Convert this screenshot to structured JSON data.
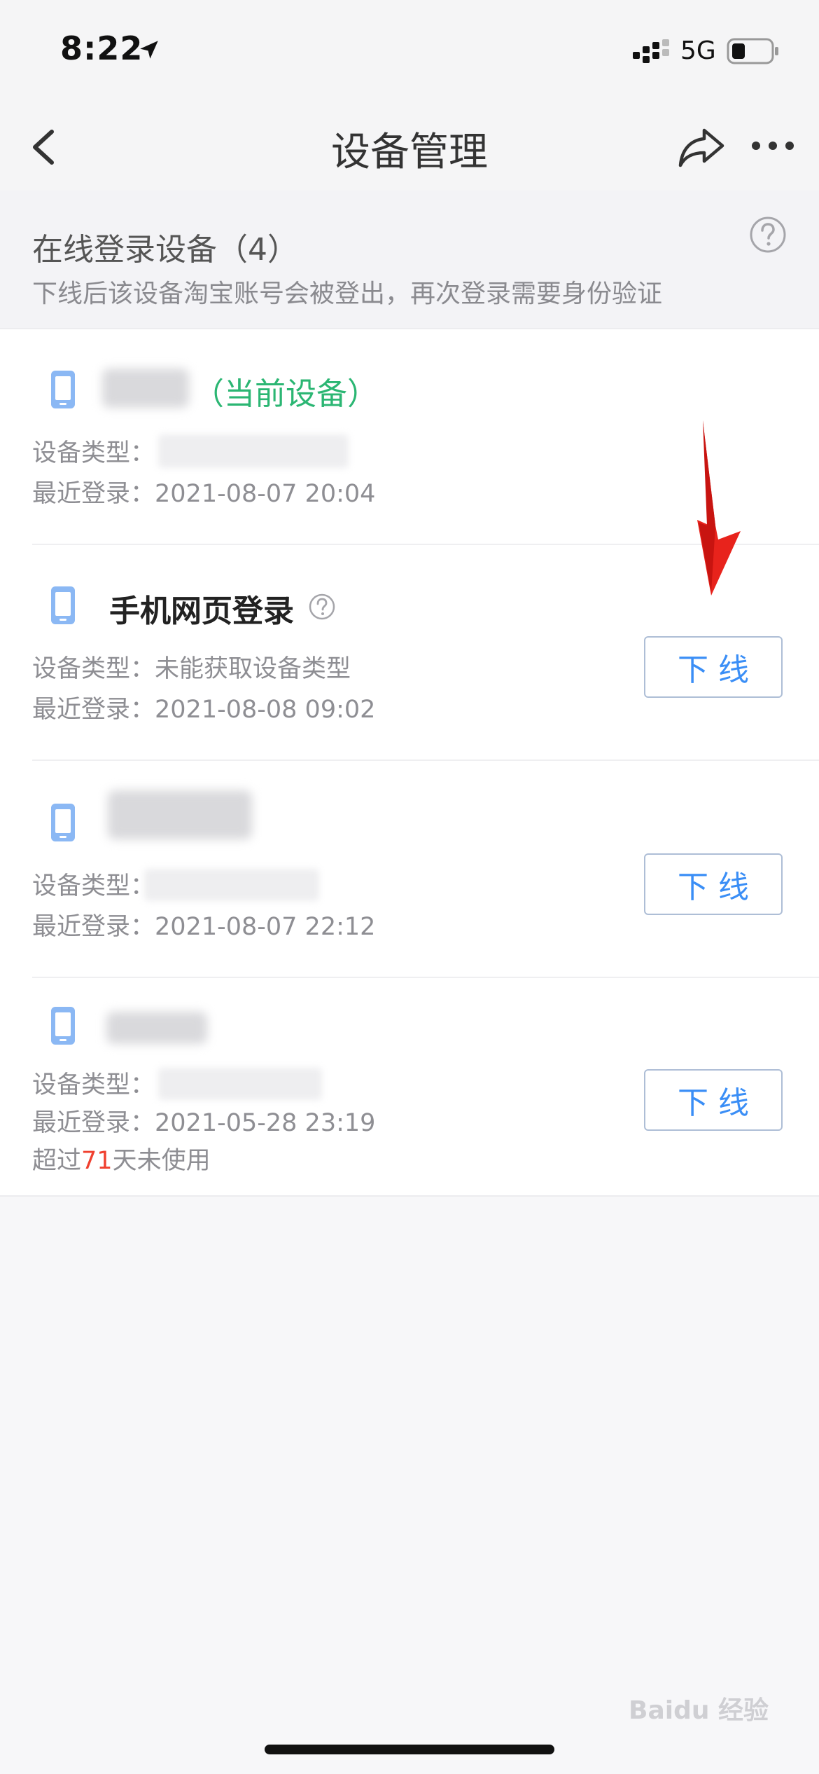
{
  "status_bar": {
    "time": "8:22",
    "network": "5G"
  },
  "nav": {
    "title": "设备管理"
  },
  "info": {
    "title": "在线登录设备（4）",
    "description": "下线后该设备淘宝账号会被登出，再次登录需要身份验证"
  },
  "labels": {
    "device_type": "设备类型：",
    "last_login": "最近登录：",
    "offline_button": "下线"
  },
  "devices": [
    {
      "name": "",
      "tag": "（当前设备）",
      "device_type": "",
      "last_login": "2021-08-07 20:04"
    },
    {
      "name": "手机网页登录",
      "device_type": "未能获取设备类型",
      "last_login": "2021-08-08 09:02"
    },
    {
      "name": "",
      "device_type": "",
      "last_login": "2021-08-07 22:12"
    },
    {
      "name": "",
      "device_type": "",
      "last_login": "2021-05-28 23:19",
      "unused_prefix": "超过",
      "unused_days": "71",
      "unused_suffix": "天未使用"
    }
  ],
  "watermark": "Baidu 经验",
  "colors": {
    "accent_blue": "#3a8ef6",
    "current_green": "#2bb673",
    "warning_red": "#f0402f",
    "phone_icon": "#8bb8f4"
  },
  "icons": [
    "location-arrow-icon",
    "signal-icon",
    "battery-icon",
    "back-icon",
    "share-icon",
    "more-icon",
    "help-icon",
    "phone-icon",
    "red-arrow-annotation"
  ]
}
